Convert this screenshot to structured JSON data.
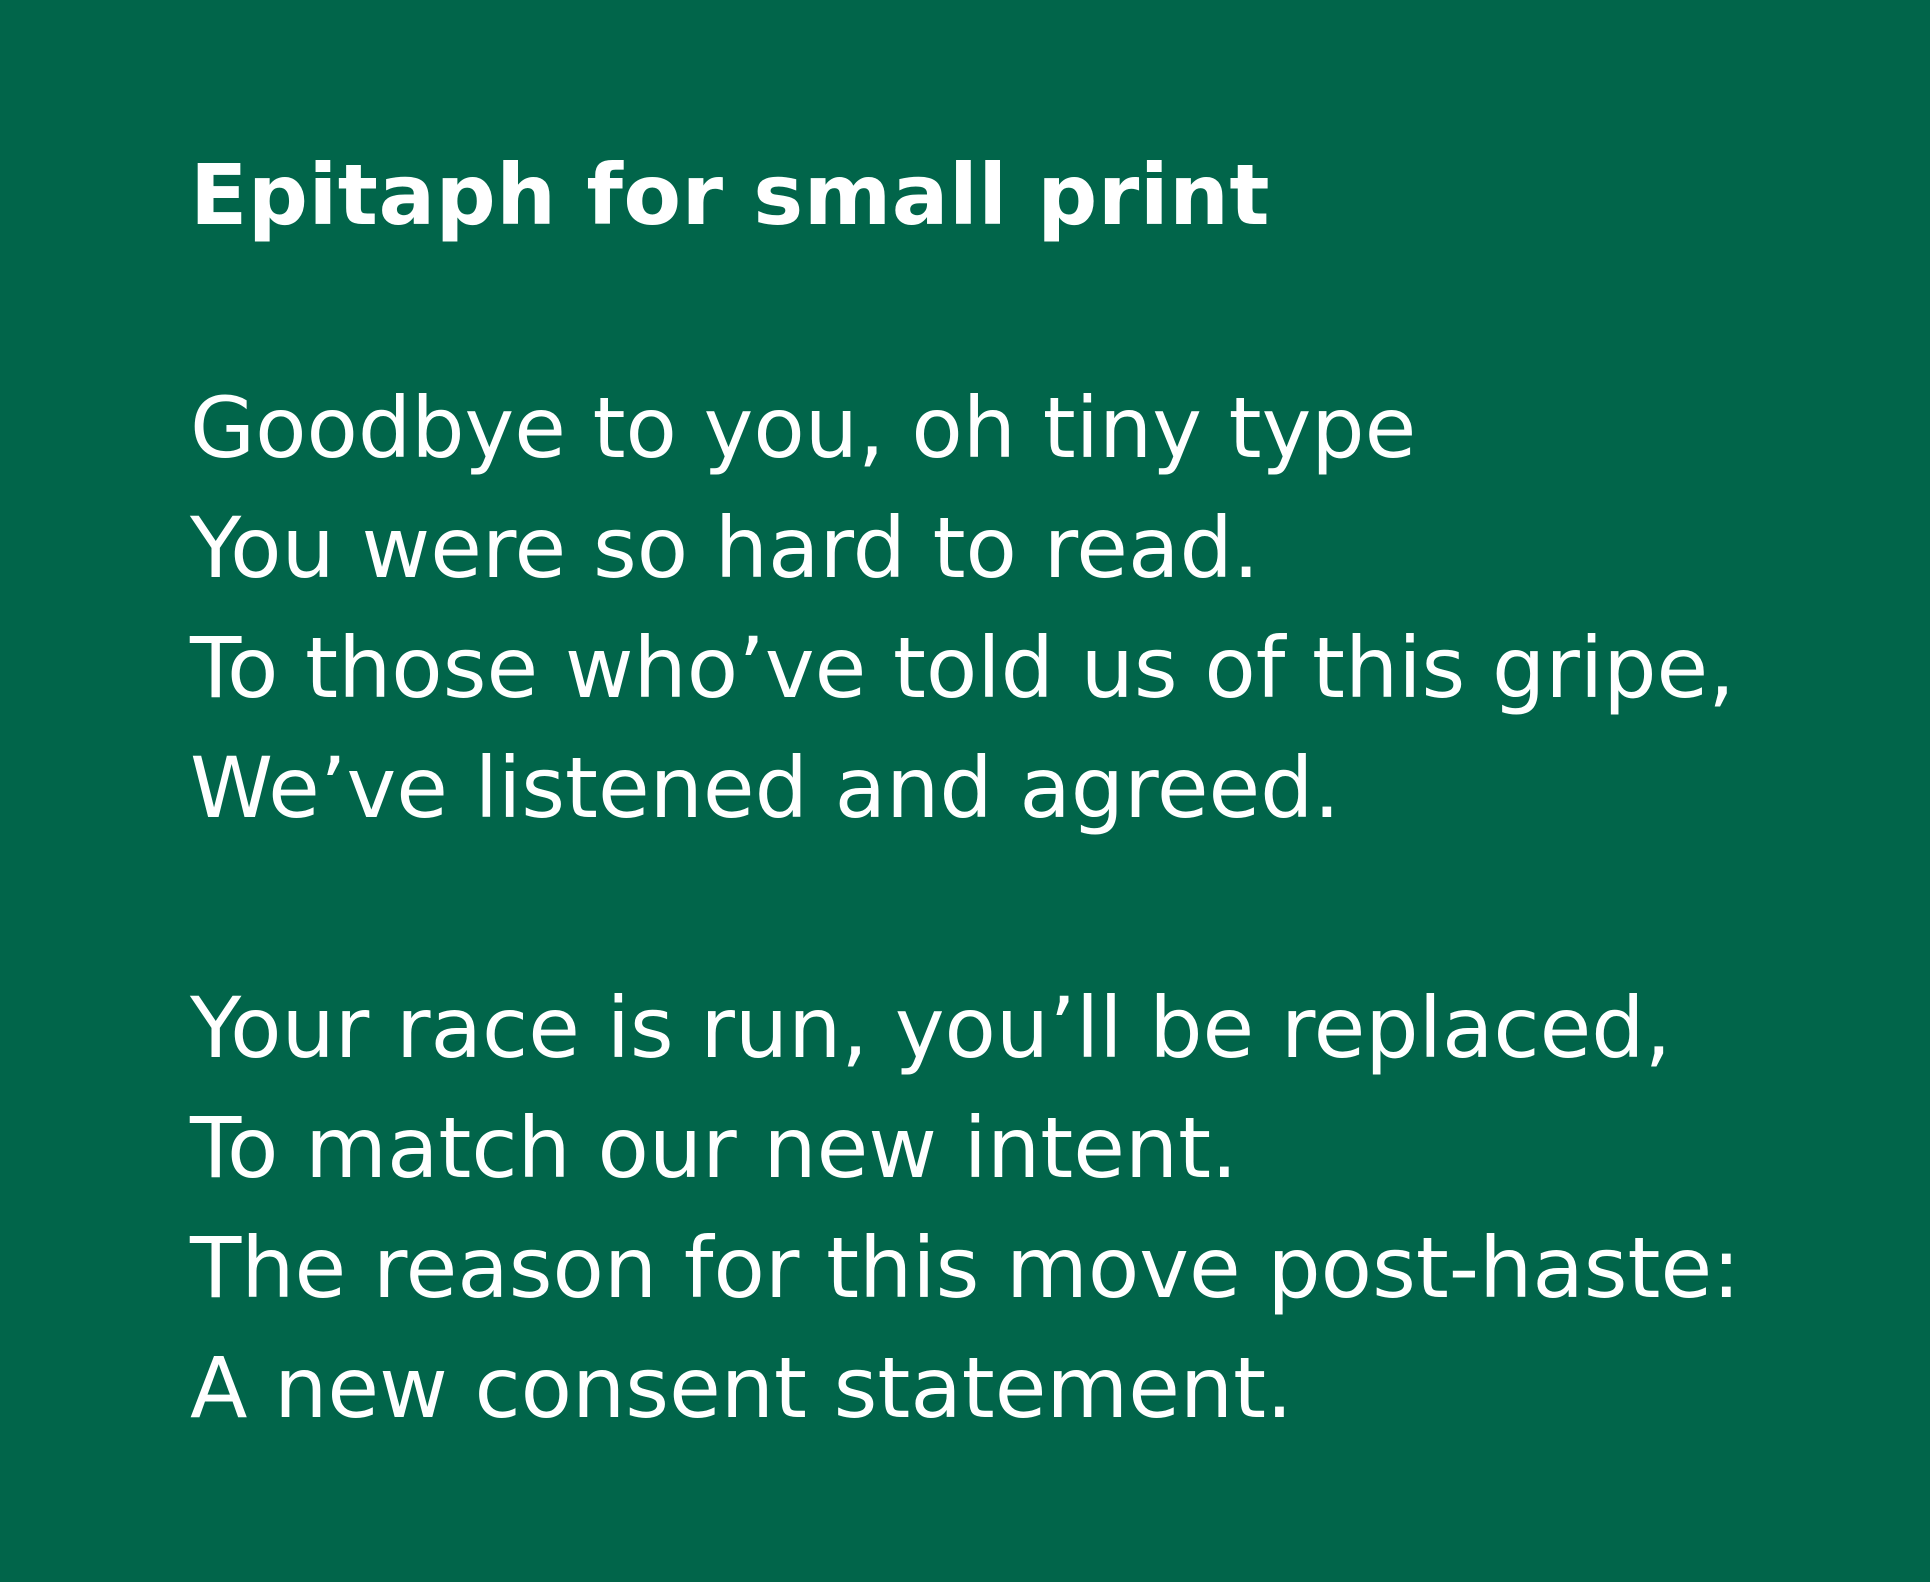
{
  "background_color": "#01654a",
  "text_color": "#ffffff",
  "title": "Epitaph for small print",
  "stanzas": [
    {
      "lines": [
        "Goodbye to you, oh tiny type",
        "You were so hard to read.",
        "To those who’ve told us of this gripe,",
        "We’ve listened and agreed."
      ]
    },
    {
      "lines": [
        "Your race is run, you’ll be replaced,",
        "To match our new intent.",
        "The reason for this move post-haste:",
        "A new consent statement."
      ]
    }
  ]
}
